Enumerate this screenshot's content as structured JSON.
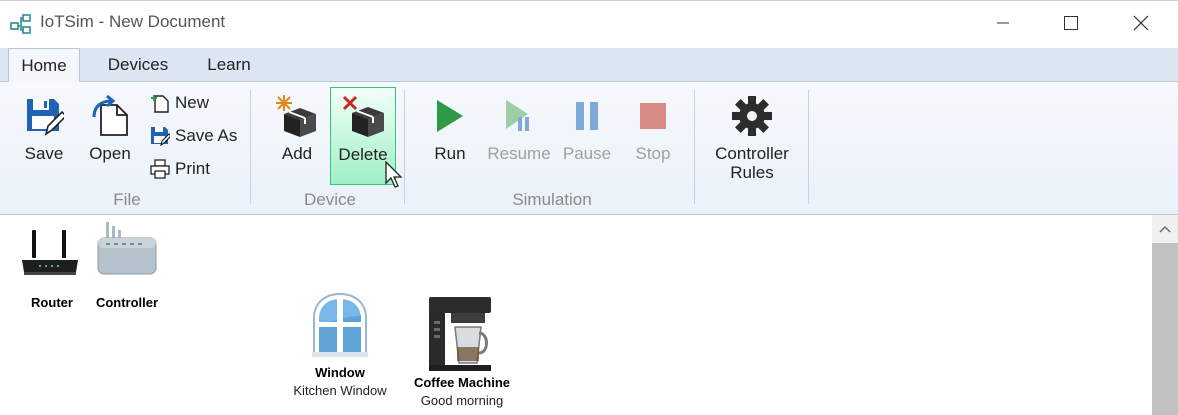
{
  "window": {
    "title": "IoTSim - New Document",
    "controls": [
      "minimize-icon",
      "maximize-icon",
      "close-icon"
    ]
  },
  "tabs": [
    {
      "label": "Home",
      "active": true
    },
    {
      "label": "Devices",
      "active": false
    },
    {
      "label": "Learn",
      "active": false
    }
  ],
  "ribbon": {
    "file": {
      "group_label": "File",
      "save": "Save",
      "open": "Open",
      "new": "New",
      "save_as": "Save As",
      "print": "Print"
    },
    "device": {
      "group_label": "Device",
      "add": "Add",
      "delete": "Delete"
    },
    "simulation": {
      "group_label": "Simulation",
      "run": "Run",
      "resume": "Resume",
      "pause": "Pause",
      "stop": "Stop"
    },
    "controller": {
      "rules_line1": "Controller",
      "rules_line2": "Rules"
    }
  },
  "canvas": {
    "devices": [
      {
        "name": "Router",
        "subtitle": ""
      },
      {
        "name": "Controller",
        "subtitle": ""
      },
      {
        "name": "Window",
        "subtitle": "Kitchen Window"
      },
      {
        "name": "Coffee Machine",
        "subtitle": "Good morning"
      }
    ]
  },
  "colors": {
    "accent_green": "#2e9a45",
    "delete_highlight": "#9ff0c6",
    "disabled_blue": "#7fa9d6",
    "disabled_red": "#d48c84"
  }
}
